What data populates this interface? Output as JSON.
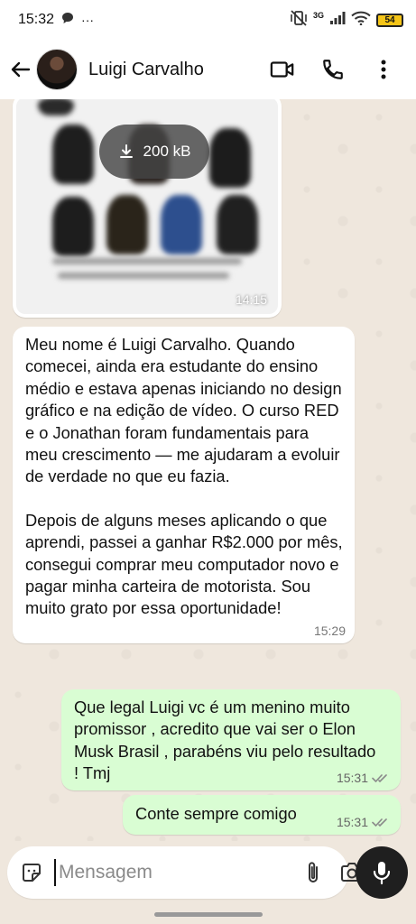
{
  "status_bar": {
    "time": "15:32",
    "more": "···",
    "network": "3G",
    "battery": "54"
  },
  "header": {
    "contact_name": "Luigi Carvalho",
    "icons": [
      "back-arrow-icon",
      "video-call-icon",
      "phone-icon",
      "more-vert-icon"
    ]
  },
  "messages": {
    "image": {
      "download_size": "200 kB",
      "time": "14:15"
    },
    "incoming": {
      "paragraph1": "Meu nome é Luigi Carvalho. Quando comecei, ainda era estudante do ensino médio e estava apenas iniciando no design gráfico e na edição de vídeo. O curso RED e o Jonathan foram fundamentais para meu crescimento — me ajudaram a evoluir de verdade no que eu fazia.",
      "paragraph2": "Depois de alguns meses aplicando o que aprendi, passei a ganhar R$2.000 por mês, consegui comprar meu computador novo e pagar minha carteira de motorista. Sou muito grato por essa oportunidade!",
      "time": "15:29"
    },
    "outgoing": [
      {
        "text": "Que legal Luigi vc é um  menino muito promissor , acredito que vai ser o Elon Musk Brasil , parabéns viu pelo resultado ! Tmj",
        "time": "15:31"
      },
      {
        "text": "Conte sempre comigo",
        "time": "15:31"
      }
    ]
  },
  "composer": {
    "placeholder": "Mensagem"
  },
  "colors": {
    "outgoing_bubble": "#d9fdd3",
    "incoming_bubble": "#ffffff",
    "chat_background": "#efe7dd",
    "read_tick": "#8a8a8a"
  }
}
